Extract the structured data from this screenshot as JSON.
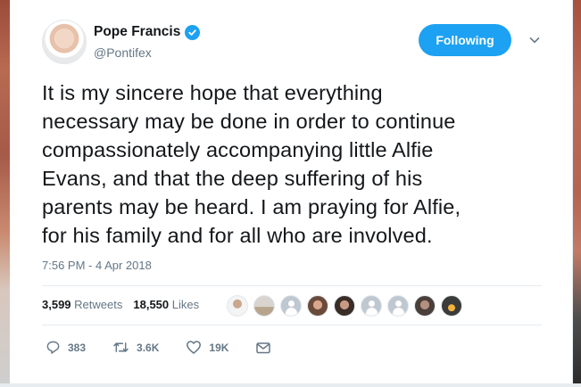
{
  "tweet": {
    "author_name": "Pope Francis",
    "handle": "@Pontifex",
    "follow_label": "Following",
    "text": "It is my sincere hope that everything\nnecessary may be done in order to continue\ncompassionately accompanying little Alfie\nEvans, and that the deep suffering of his\nparents may be heard.  I am praying for Alfie,\nfor his family and for all who are involved.",
    "timestamp": "7:56 PM - 4 Apr 2018",
    "retweets_count": "3,599",
    "retweets_label": "Retweets",
    "likes_count": "18,550",
    "likes_label": "Likes",
    "actions": {
      "reply_count": "383",
      "retweet_count": "3.6K",
      "like_count": "19K"
    }
  },
  "colors": {
    "accent": "#1da1f2",
    "text": "#14171a",
    "muted": "#657786"
  },
  "icons": [
    "verified-badge-icon",
    "chevron-down-icon",
    "reply-icon",
    "retweet-icon",
    "like-icon",
    "direct-message-icon"
  ]
}
